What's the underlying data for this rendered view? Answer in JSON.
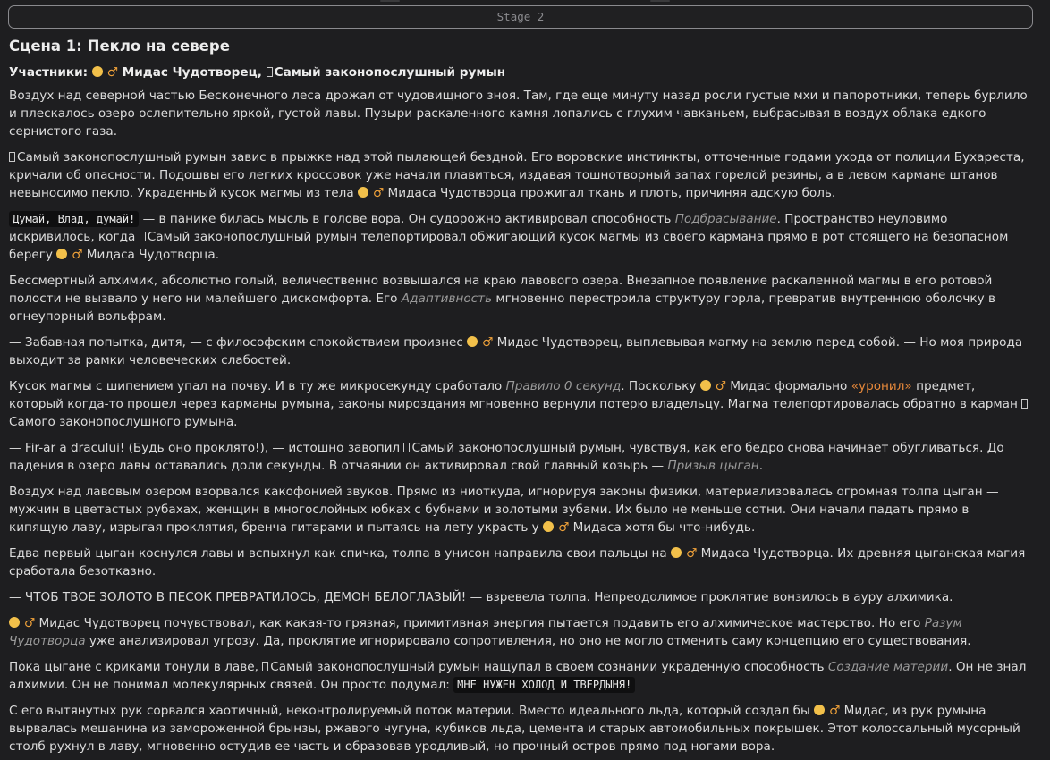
{
  "stage_label": "Stage 2",
  "scene_title": "Сцена 1: Пекло на севере",
  "participants": {
    "label": "Участники:",
    "midas": "Мидас Чудотворец,",
    "romanian": "Самый законопослушный румын"
  },
  "male_sign": "♂",
  "p1": "Воздух над северной частью Бесконечного леса дрожал от чудовищного зноя. Там, где еще минуту назад росли густые мхи и папоротники, теперь бурлило и плескалось озеро ослепительно яркой, густой лавы. Пузыри раскаленного камня лопались с глухим чавканьем, выбрасывая в воздух облака едкого сернистого газа.",
  "p2": {
    "a": "Самый законопослушный румын завис в прыжке над этой пылающей бездной. Его воровские инстинкты, отточенные годами ухода от полиции Бухареста, кричали об опасности. Подошвы его легких кроссовок уже начали плавиться, издавая тошнотворный запах горелой резины, а в левом кармане штанов невыносимо пекло. Украденный кусок магмы из тела",
    "b": "Мидаса Чудотворца прожигал ткань и плоть, причиняя адскую боль."
  },
  "p3": {
    "code": "Думай, Влад, думай!",
    "a": "— в панике билась мысль в голове вора. Он судорожно активировал способность",
    "ability": "Подбрасывание",
    "b": ". Пространство неуловимо искривилось, когда",
    "c": "Самый законопослушный румын телепортировал обжигающий кусок магмы из своего кармана прямо в рот стоящего на безопасном берегу",
    "d": "Мидаса Чудотворца."
  },
  "p4": {
    "a": "Бессмертный алхимик, абсолютно голый, величественно возвышался на краю лавового озера. Внезапное появление раскаленной магмы в его ротовой полости не вызвало у него ни малейшего дискомфорта. Его",
    "ability": "Адаптивность",
    "b": "мгновенно перестроила структуру горла, превратив внутреннюю оболочку в огнеупорный вольфрам."
  },
  "p5": {
    "a": "— Забавная попытка, дитя, — с философским спокойствием произнес",
    "b": "Мидас Чудотворец, выплевывая магму на землю перед собой. — Но моя природа выходит за рамки человеческих слабостей."
  },
  "p6": {
    "a": "Кусок магмы с шипением упал на почву. И в ту же микросекунду сработало",
    "ability": "Правило 0 секунд",
    "b": ". Поскольку",
    "c": "Мидас формально",
    "accent": "«уронил»",
    "d": "предмет, который когда-то прошел через карманы румына, законы мироздания мгновенно вернули потерю владельцу. Магма телепортировалась обратно в карман",
    "e": "Самого законопослушного румына."
  },
  "p7": {
    "a": "— Fir-ar a dracului! (Будь оно проклято!), — истошно завопил",
    "b": "Самый законопослушный румын, чувствуя, как его бедро снова начинает обугливаться. До падения в озеро лавы оставались доли секунды. В отчаянии он активировал свой главный козырь —",
    "ability": "Призыв цыган",
    "c": "."
  },
  "p8": {
    "a": "Воздух над лавовым озером взорвался какофонией звуков. Прямо из ниоткуда, игнорируя законы физики, материализовалась огромная толпа цыган — мужчин в цветастых рубахах, женщин в многослойных юбках с бубнами и золотыми зубами. Их было не меньше сотни. Они начали падать прямо в кипящую лаву, изрыгая проклятия, бренча гитарами и пытаясь на лету украсть у",
    "b": "Мидаса хотя бы что-нибудь."
  },
  "p9": {
    "a": "Едва первый цыган коснулся лавы и вспыхнул как спичка, толпа в унисон направила свои пальцы на",
    "b": "Мидаса Чудотворца. Их древняя цыганская магия сработала безотказно."
  },
  "p10": "— ЧТОБ ТВОЕ ЗОЛОТО В ПЕСОК ПРЕВРАТИЛОСЬ, ДЕМОН БЕЛОГЛАЗЫЙ! — взревела толпа. Непреодолимое проклятие вонзилось в ауру алхимика.",
  "p11": {
    "a": "Мидас Чудотворец почувствовал, как какая-то грязная, примитивная энергия пытается подавить его алхимическое мастерство. Но его",
    "ability": "Разум Чудотворца",
    "b": "уже анализировал угрозу. Да, проклятие игнорировало сопротивления, но оно не могло отменить саму концепцию его существования."
  },
  "p12": {
    "a": "Пока цыгане с криками тонули в лаве,",
    "b": "Самый законопослушный румын нащупал в своем сознании украденную способность",
    "ability": "Создание материи",
    "c": ". Он не знал алхимии. Он не понимал молекулярных связей. Он просто подумал:",
    "code": "МНЕ НУЖЕН ХОЛОД И ТВЕРДЫНЯ!"
  },
  "p13": {
    "a": "С его вытянутых рук сорвался хаотичный, неконтролируемый поток материи. Вместо идеального льда, который создал бы",
    "b": "Мидас, из рук румына вырвалась мешанина из замороженной брынзы, ржавого чугуна, кубиков льда, цемента и старых автомобильных покрышек. Этот колоссальный мусорный столб рухнул в лаву, мгновенно остудив ее часть и образовав уродливый, но прочный остров прямо под ногами вора."
  }
}
